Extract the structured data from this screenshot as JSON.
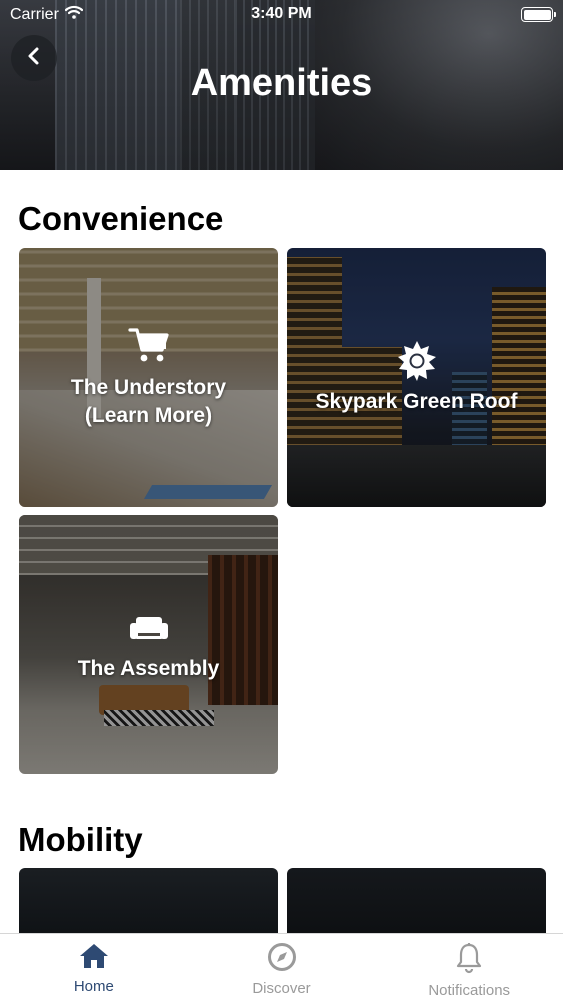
{
  "status_bar": {
    "carrier": "Carrier",
    "time": "3:40 PM"
  },
  "header": {
    "title": "Amenities",
    "back_icon": "chevron-left-icon"
  },
  "sections": [
    {
      "title": "Convenience",
      "cards": [
        {
          "label_line1": "The Understory",
          "label_line2": "(Learn More)",
          "icon": "shopping-cart-icon"
        },
        {
          "label_line1": "Skypark Green Roof",
          "icon": "sun-icon"
        },
        {
          "label_line1": "The Assembly",
          "icon": "sofa-icon"
        }
      ]
    },
    {
      "title": "Mobility",
      "cards": []
    }
  ],
  "tab_bar": {
    "tabs": [
      {
        "label": "Home",
        "icon": "home-icon",
        "active": true
      },
      {
        "label": "Discover",
        "icon": "compass-icon",
        "active": false
      },
      {
        "label": "Notifications",
        "icon": "bell-icon",
        "active": false
      }
    ]
  },
  "colors": {
    "tab_active": "#2e4a73",
    "tab_inactive": "#9a9a9a",
    "header_bg": "#2a2c31"
  }
}
